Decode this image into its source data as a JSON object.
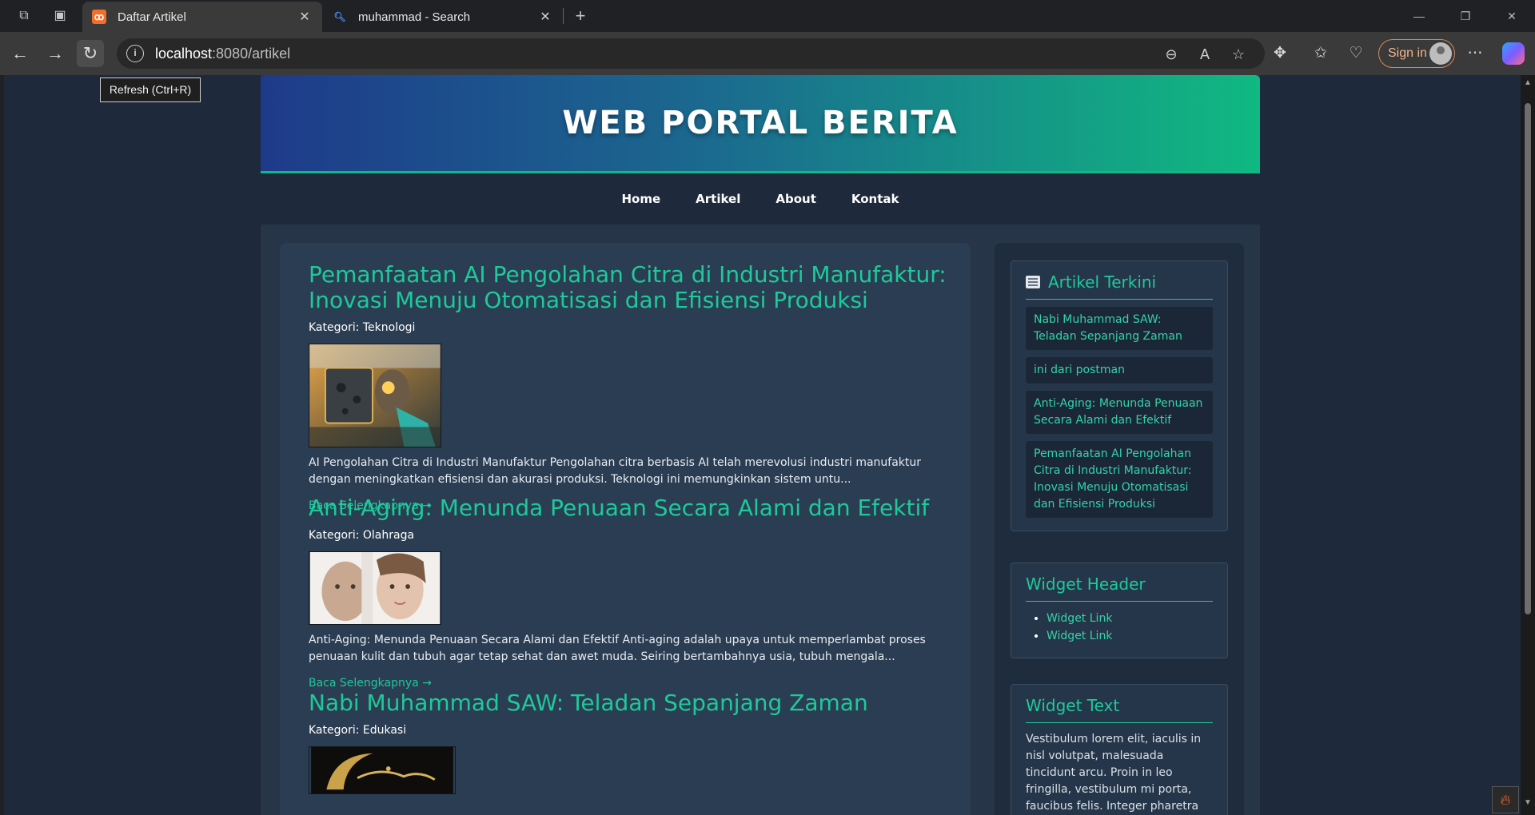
{
  "browser": {
    "tabs": [
      {
        "title": "Daftar Artikel",
        "active": true,
        "favicon": "xampp-icon",
        "favicon_color": "#f26e2b"
      },
      {
        "title": "muhammad - Search",
        "active": false,
        "favicon": "search-icon"
      }
    ],
    "new_tab_label": "+",
    "address": {
      "host": "localhost",
      "rest": ":8080/artikel"
    },
    "sign_in_label": "Sign in",
    "tooltip": "Refresh (Ctrl+R)"
  },
  "site": {
    "title": "WEB PORTAL BERITA",
    "nav": [
      "Home",
      "Artikel",
      "About",
      "Kontak"
    ],
    "colors": {
      "accent": "#10b981",
      "header_start": "#1e3a8a",
      "header_end": "#10b981"
    }
  },
  "articles": [
    {
      "title": "Pemanfaatan AI Pengolahan Citra di Industri Manufaktur: Inovasi Menuju Otomatisasi dan Efisiensi Produksi",
      "category": "Kategori: Teknologi",
      "excerpt": "AI Pengolahan Citra di Industri Manufaktur Pengolahan citra berbasis AI telah merevolusi industri manufaktur dengan meningkatkan efisiensi dan akurasi produksi. Teknologi ini memungkinkan sistem untu...",
      "more": "Baca Selengkapnya →"
    },
    {
      "title": "Anti-Aging: Menunda Penuaan Secara Alami dan Efektif",
      "category": "Kategori: Olahraga",
      "excerpt": "Anti-Aging: Menunda Penuaan Secara Alami dan Efektif Anti-aging adalah upaya untuk memperlambat proses penuaan kulit dan tubuh agar tetap sehat dan awet muda. Seiring bertambahnya usia, tubuh mengala...",
      "more": "Baca Selengkapnya →"
    },
    {
      "title": "Nabi Muhammad SAW: Teladan Sepanjang Zaman",
      "category": "Kategori: Edukasi"
    }
  ],
  "sidebar": {
    "recent": {
      "title": "Artikel Terkini",
      "items": [
        "Nabi Muhammad SAW: Teladan Sepanjang Zaman",
        "ini dari postman",
        "Anti-Aging: Menunda Penuaan Secara Alami dan Efektif",
        "Pemanfaatan AI Pengolahan Citra di Industri Manufaktur: Inovasi Menuju Otomatisasi dan Efisiensi Produksi"
      ]
    },
    "widget_header": {
      "title": "Widget Header",
      "links": [
        "Widget Link",
        "Widget Link"
      ]
    },
    "widget_text": {
      "title": "Widget Text",
      "text": "Vestibulum lorem elit, iaculis in nisl volutpat, malesuada tincidunt arcu. Proin in leo fringilla, vestibulum mi porta, faucibus felis. Integer pharetra est nunc, nec"
    }
  }
}
